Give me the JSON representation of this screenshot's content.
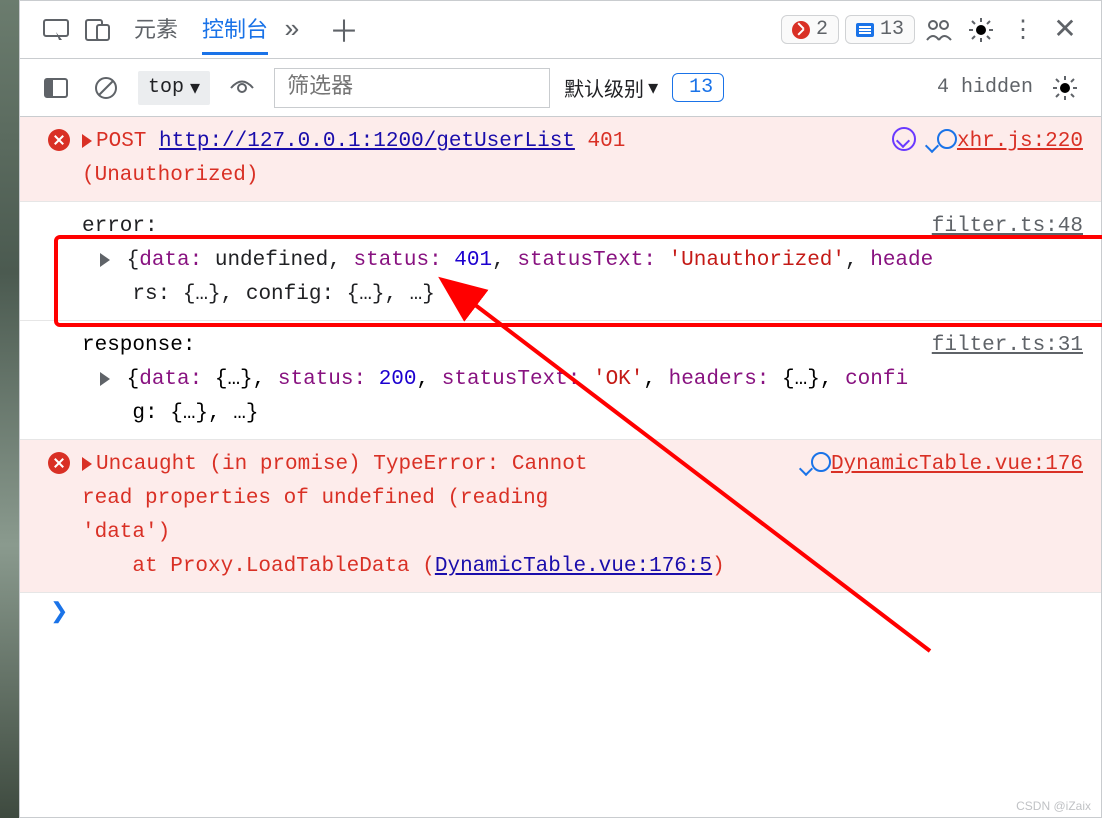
{
  "topbar": {
    "tab_elements": "元素",
    "tab_console": "控制台",
    "error_count": "2",
    "issue_count1": "13"
  },
  "secbar": {
    "context": "top",
    "filter_placeholder": "筛选器",
    "level_label": "默认级别",
    "issue_count2": "13",
    "hidden_label": "4 hidden"
  },
  "row1": {
    "method": "POST",
    "url": "http://127.0.0.1:1200/getUserList",
    "code": "401",
    "statusline": "(Unauthorized)",
    "src": "xhr.js:220"
  },
  "row2": {
    "label": "error:",
    "src": "filter.ts:48",
    "obj_pre": "{",
    "p1": "data:",
    "v1": " undefined",
    "p2": "status:",
    "v2": " 401",
    "p3": "statusText:",
    "v3": " 'Unauthorized'",
    "p4": "heade",
    "cont": "rs: {…}, config: {…}, …}"
  },
  "row3": {
    "label": "response:",
    "src": "filter.ts:31",
    "pre": "{",
    "p1": "data:",
    "v1": " {…}",
    "p2": "status:",
    "v2": " 200",
    "p3": "statusText:",
    "v3": " 'OK'",
    "p4": "headers:",
    "v4": " {…}",
    "p5": "confi",
    "cont": "g: {…}, …}"
  },
  "row4": {
    "msg1": "Uncaught (in promise) TypeError: Cannot",
    "msg2": "read properties of undefined (reading",
    "msg3": "'data')",
    "stack_pre": "    at Proxy.LoadTableData (",
    "stack_link": "DynamicTable.vue:176:5",
    "stack_post": ")",
    "src": "DynamicTable.vue:176"
  },
  "watermark": "CSDN @iZaix"
}
